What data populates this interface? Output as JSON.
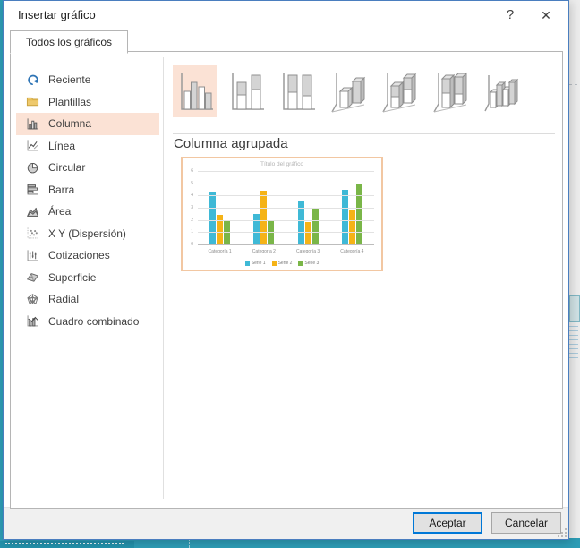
{
  "window": {
    "title": "Insertar gráfico",
    "help_glyph": "?",
    "close_glyph": "✕"
  },
  "tabs": [
    {
      "label": "Todos los gráficos"
    }
  ],
  "sidebar": {
    "selected_index": 2,
    "items": [
      {
        "label": "Reciente"
      },
      {
        "label": "Plantillas"
      },
      {
        "label": "Columna"
      },
      {
        "label": "Línea"
      },
      {
        "label": "Circular"
      },
      {
        "label": "Barra"
      },
      {
        "label": "Área"
      },
      {
        "label": "X Y (Dispersión)"
      },
      {
        "label": "Cotizaciones"
      },
      {
        "label": "Superficie"
      },
      {
        "label": "Radial"
      },
      {
        "label": "Cuadro combinado"
      }
    ]
  },
  "gallery": {
    "tile_count": 7,
    "selected_index": 0
  },
  "section": {
    "heading": "Columna agrupada"
  },
  "chart_data": {
    "type": "bar",
    "title": "Título del gráfico",
    "categories": [
      "Categoría 1",
      "Categoría 2",
      "Categoría 3",
      "Categoría 4"
    ],
    "series": [
      {
        "name": "Serie 1",
        "values": [
          4.3,
          2.5,
          3.5,
          4.5
        ],
        "color": "#3FB9D6"
      },
      {
        "name": "Serie 2",
        "values": [
          2.4,
          4.4,
          1.8,
          2.8
        ],
        "color": "#F5B317"
      },
      {
        "name": "Serie 3",
        "values": [
          2.0,
          2.0,
          3.0,
          5.0
        ],
        "color": "#7AB648"
      }
    ],
    "xlabel": "",
    "ylabel": "",
    "ylim": [
      0,
      6
    ],
    "ytick_step": 1,
    "grid": true,
    "legend_position": "bottom"
  },
  "footer": {
    "ok_label": "Aceptar",
    "cancel_label": "Cancelar"
  },
  "colors": {
    "dialog_border": "#4A7EBF",
    "selection_highlight": "#FBE2D5",
    "preview_border": "#F2C7A2",
    "default_button_border": "#0078D7",
    "background_teal": "#2D9CB5"
  }
}
